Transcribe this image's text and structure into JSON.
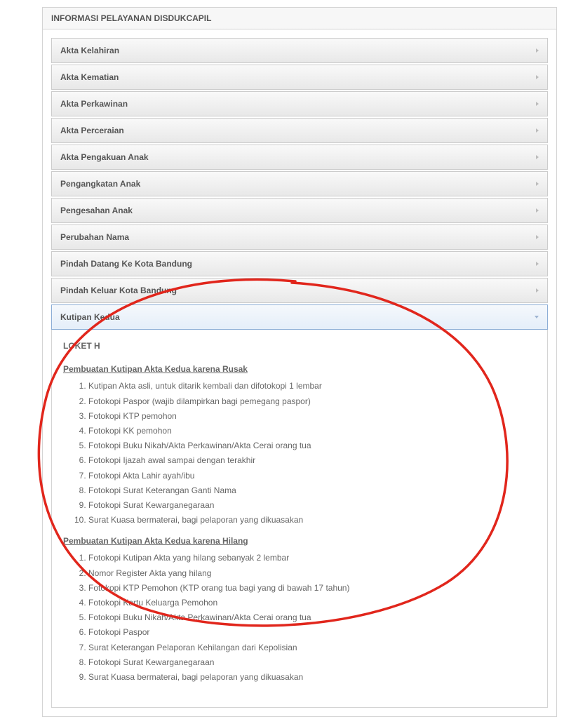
{
  "panel": {
    "title": "INFORMASI PELAYANAN DISDUKCAPIL"
  },
  "accordion": {
    "items": [
      {
        "label": "Akta Kelahiran"
      },
      {
        "label": "Akta Kematian"
      },
      {
        "label": "Akta Perkawinan"
      },
      {
        "label": "Akta Perceraian"
      },
      {
        "label": "Akta Pengakuan Anak"
      },
      {
        "label": "Pengangkatan Anak"
      },
      {
        "label": "Pengesahan Anak"
      },
      {
        "label": "Perubahan Nama"
      },
      {
        "label": "Pindah Datang Ke Kota Bandung"
      },
      {
        "label": "Pindah Keluar Kota Bandung"
      },
      {
        "label": "Kutipan Kedua"
      }
    ]
  },
  "content": {
    "loket": "LOKET H",
    "section1": {
      "title": "Pembuatan Kutipan Akta Kedua karena Rusak",
      "items": [
        "Kutipan Akta asli, untuk ditarik kembali dan difotokopi 1 lembar",
        "Fotokopi Paspor (wajib dilampirkan bagi pemegang paspor)",
        "Fotokopi KTP pemohon",
        "Fotokopi KK pemohon",
        "Fotokopi Buku Nikah/Akta Perkawinan/Akta Cerai orang tua",
        "Fotokopi Ijazah awal sampai dengan terakhir",
        "Fotokopi Akta Lahir ayah/ibu",
        "Fotokopi Surat Keterangan Ganti Nama",
        "Fotokopi Surat Kewarganegaraan",
        "Surat Kuasa bermaterai, bagi pelaporan yang dikuasakan"
      ]
    },
    "section2": {
      "title": "Pembuatan Kutipan Akta Kedua karena Hilang",
      "items": [
        "Fotokopi Kutipan Akta yang hilang sebanyak 2 lembar",
        "Nomor Register Akta yang hilang",
        "Fotokopi KTP Pemohon (KTP orang tua bagi yang di bawah 17 tahun)",
        "Fotokopi Kartu Keluarga Pemohon",
        "Fotokopi Buku Nikah/Akta Perkawinan/Akta Cerai orang tua",
        "Fotokopi Paspor",
        "Surat Keterangan Pelaporan Kehilangan dari Kepolisian",
        "Fotokopi Surat Kewarganegaraan",
        "Surat Kuasa bermaterai, bagi pelaporan yang dikuasakan"
      ]
    }
  }
}
